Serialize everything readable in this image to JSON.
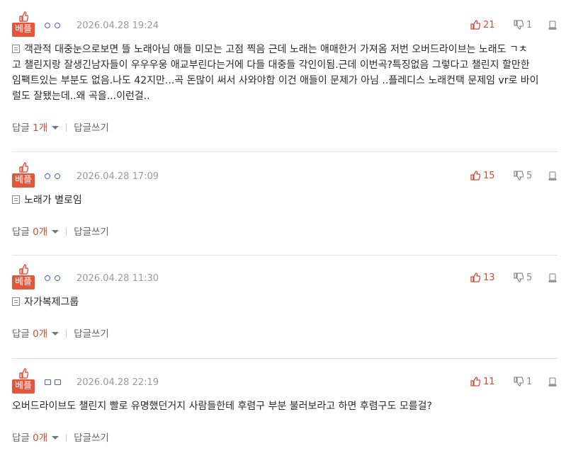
{
  "colors": {
    "accent": "#e5553b",
    "like": "#d34b33",
    "nick": "#4a66c8"
  },
  "comments": [
    {
      "best_label": "베플",
      "nick_style": "circle",
      "date": "2026.04.28 19:24",
      "likes": "21",
      "dislikes": "1",
      "lines": [
        "객관적 대중눈으로보면 뜰 노래아님 애들 미모는 고점 찍음 근데 노래는 애매한거 가져옴 저번 오버드라이브는 노래도 ㄱㅊ",
        "고 챌린지랑 잘생긴남자들이 우우우웅 애교부린다는거에 다들 대중들 각인이됨.근데 이번곡?특징없음 그렇다고 챌린지 할만한",
        "임팩트있는 부분도 없음.나도 42지만...곡 돈많이 써서 사와야함 이건 애들이 문제가 아님 ..플레디스 노래컨택 문제임 vr로 바이",
        "럴도 잘됐는데..왜 곡을...이런걸.."
      ],
      "reply_label": "답글",
      "reply_count": "1개",
      "write_label": "답글쓰기"
    },
    {
      "best_label": "베플",
      "nick_style": "circle",
      "date": "2026.04.28 17:09",
      "likes": "15",
      "dislikes": "5",
      "lines": [
        "노래가 별로임"
      ],
      "reply_label": "답글",
      "reply_count": "0개",
      "write_label": "답글쓰기"
    },
    {
      "best_label": "베플",
      "nick_style": "circle",
      "date": "2026.04.28 11:30",
      "likes": "13",
      "dislikes": "5",
      "lines": [
        "자가복제그룹"
      ],
      "reply_label": "답글",
      "reply_count": "0개",
      "write_label": "답글쓰기"
    },
    {
      "best_label": "베플",
      "nick_style": "square",
      "date": "2026.04.28 22:19",
      "likes": "11",
      "dislikes": "1",
      "lines": [
        "오버드라이브도 챌린지 빨로 유명했던거지 사람들한테 후렴구 부분 불러보라고 하면 후렴구도 모를걸?"
      ],
      "reply_label": "답글",
      "reply_count": "0개",
      "write_label": "답글쓰기"
    }
  ]
}
